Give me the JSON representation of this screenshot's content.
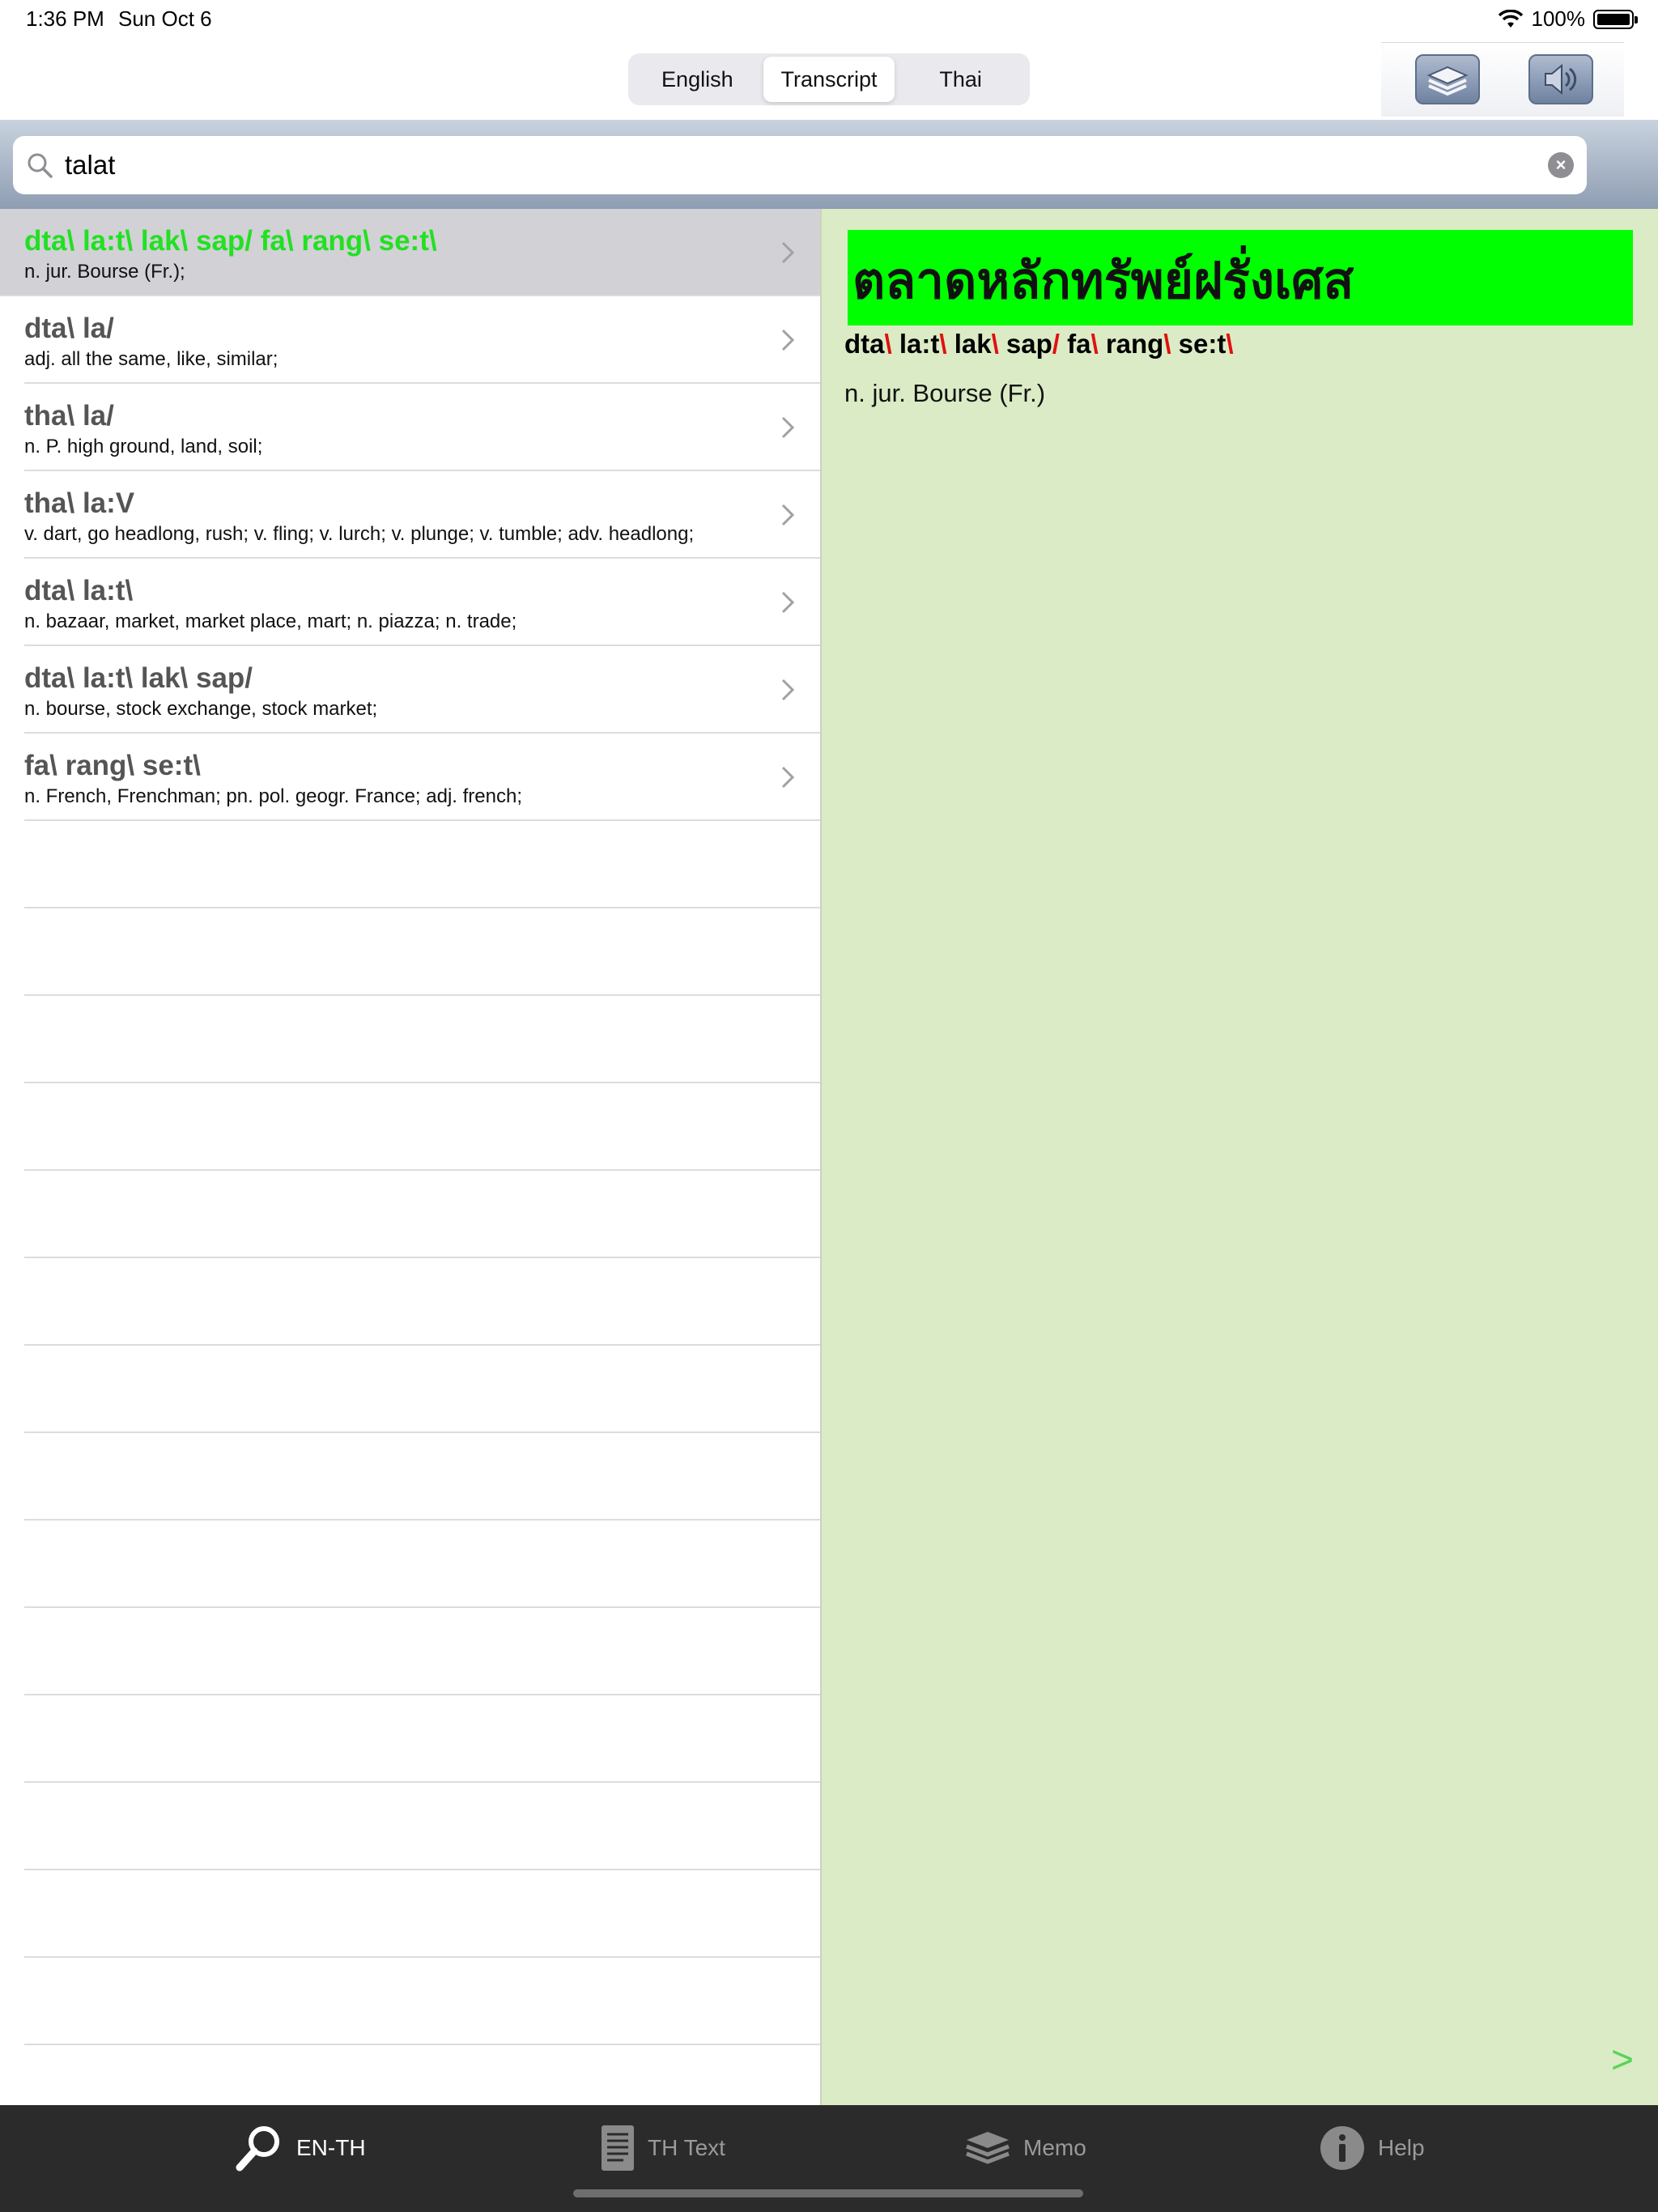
{
  "status": {
    "time": "1:36 PM",
    "date": "Sun Oct 6",
    "battery": "100%"
  },
  "segments": [
    {
      "label": "English",
      "active": false
    },
    {
      "label": "Transcript",
      "active": true
    },
    {
      "label": "Thai",
      "active": false
    }
  ],
  "toolbar": {
    "layers_icon": "layers-icon",
    "sound_icon": "speaker-icon"
  },
  "search": {
    "value": "talat",
    "placeholder": ""
  },
  "results": [
    {
      "title": "dta\\ la:t\\ lak\\ sap/ fa\\ rang\\ se:t\\",
      "def": "n. jur. Bourse (Fr.);",
      "selected": true
    },
    {
      "title": "dta\\ la/",
      "def": "adj. all the same, like, similar;",
      "selected": false
    },
    {
      "title": "tha\\ la/",
      "def": "n. P. high ground, land, soil;",
      "selected": false
    },
    {
      "title": "tha\\ la:V",
      "def": "v. dart, go headlong, rush; v. fling; v. lurch; v. plunge; v. tumble; adv. headlong;",
      "selected": false
    },
    {
      "title": "dta\\ la:t\\",
      "def": "n. bazaar, market, market place, mart; n. piazza; n. trade;",
      "selected": false
    },
    {
      "title": "dta\\ la:t\\ lak\\ sap/",
      "def": "n. bourse, stock exchange, stock market;",
      "selected": false
    },
    {
      "title": "fa\\ rang\\ se:t\\",
      "def": "n. French, Frenchman; pn. pol. geogr. France; adj. french;",
      "selected": false
    }
  ],
  "detail": {
    "thai": "ตลาดหลักทรัพย์ฝรั่งเศส",
    "transcript": [
      {
        "syl": "dta",
        "sep": "\\"
      },
      {
        "syl": "la:t",
        "sep": "\\"
      },
      {
        "syl": "lak",
        "sep": "\\"
      },
      {
        "syl": "sap",
        "sep": "/"
      },
      {
        "syl": "fa",
        "sep": "\\"
      },
      {
        "syl": "rang",
        "sep": "\\"
      },
      {
        "syl": "se:t",
        "sep": "\\"
      }
    ],
    "meaning": "n. jur. Bourse (Fr.)",
    "next_label": ">"
  },
  "tabs": [
    {
      "label": "EN-TH",
      "icon": "magnifier-icon",
      "active": true
    },
    {
      "label": "TH Text",
      "icon": "document-icon",
      "active": false
    },
    {
      "label": "Memo",
      "icon": "layers-icon",
      "active": false
    },
    {
      "label": "Help",
      "icon": "info-icon",
      "active": false
    }
  ],
  "colors": {
    "selected_title": "#22e022",
    "thai_highlight": "#00ff00",
    "separator": "#e01010",
    "detail_bg": "#dbebc5"
  }
}
